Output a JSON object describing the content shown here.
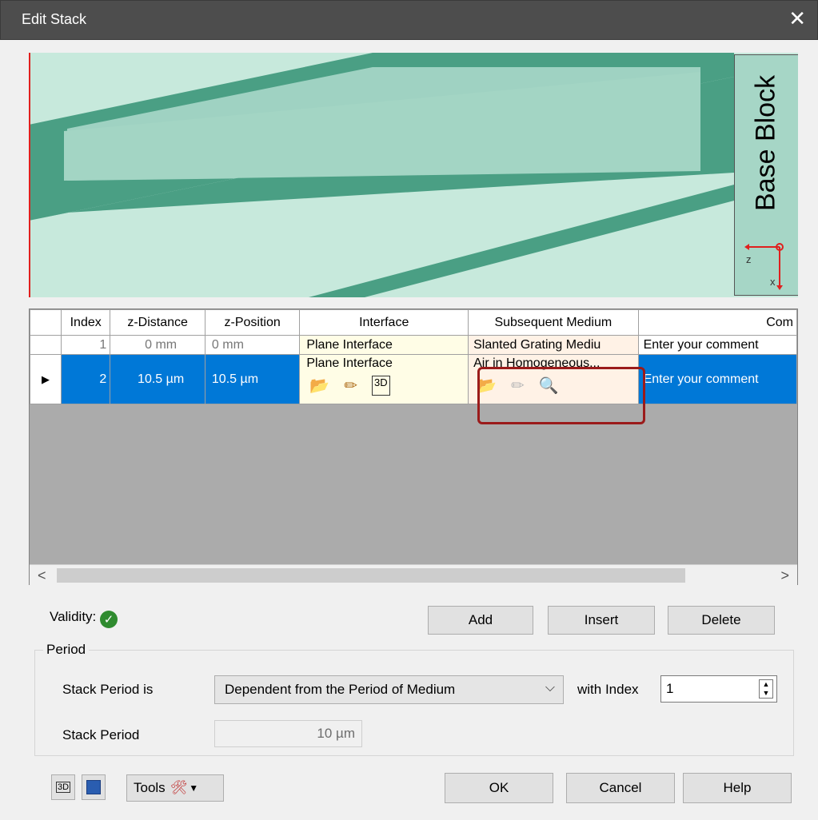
{
  "window": {
    "title": "Edit Stack",
    "close_glyph": "✕"
  },
  "preview": {
    "block_label": "Base Block",
    "axis_z": "z",
    "axis_x": "x"
  },
  "grid": {
    "headers": [
      "",
      "Index",
      "z-Distance",
      "z-Position",
      "Interface",
      "Subsequent Medium",
      "Com"
    ],
    "rows": [
      {
        "index": "1",
        "z_distance": "0 mm",
        "z_position": "0 mm",
        "interface": "Plane Interface",
        "medium": "Slanted Grating Mediu",
        "comment": "Enter your comment"
      },
      {
        "index": "2",
        "z_distance": "10.5 µm",
        "z_position": "10.5 µm",
        "interface": "Plane Interface",
        "medium": "Air in Homogeneous...",
        "comment": "Enter your comment"
      }
    ],
    "row_marker": "▶"
  },
  "validity": {
    "label": "Validity:"
  },
  "buttons": {
    "add": "Add",
    "insert": "Insert",
    "delete": "Delete",
    "ok": "OK",
    "cancel": "Cancel",
    "help": "Help",
    "tools": "Tools"
  },
  "period": {
    "group_title": "Period",
    "stack_period_is_label": "Stack Period is",
    "combo_value": "Dependent from the Period of Medium",
    "with_index_label": "with Index",
    "index_value": "1",
    "stack_period_label": "Stack Period",
    "stack_period_value": "10 µm"
  }
}
